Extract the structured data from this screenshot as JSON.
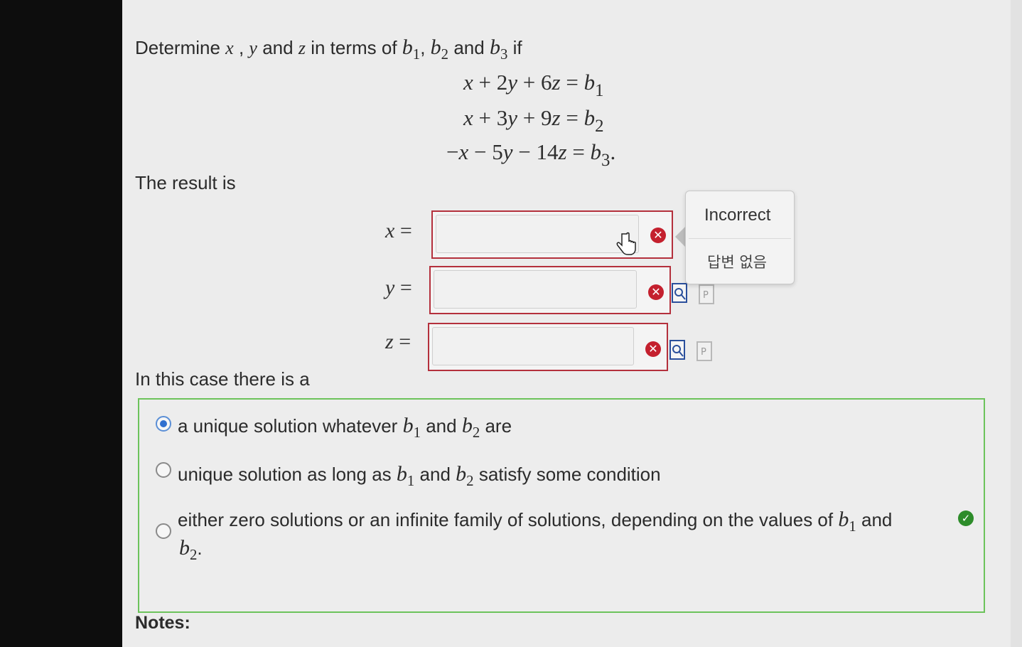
{
  "question": {
    "prefix": "Determine",
    "var_x": "x",
    "comma": ",",
    "var_y": "y",
    "and_word": "and",
    "var_z": "z",
    "in_terms_of": "in terms of",
    "b": "b",
    "sub1": "1",
    "sub2": "2",
    "sub3": "3",
    "if_word": "if"
  },
  "equations": [
    {
      "lhs_pre": "",
      "c1": "x",
      "op1": "+",
      "n2": "2",
      "c2": "y",
      "op2": "+",
      "n3": "6",
      "c3": "z",
      "eq": "=",
      "rhs": "b",
      "rsub": "1",
      "end": ""
    },
    {
      "lhs_pre": "",
      "c1": "x",
      "op1": "+",
      "n2": "3",
      "c2": "y",
      "op2": "+",
      "n3": "9",
      "c3": "z",
      "eq": "=",
      "rhs": "b",
      "rsub": "2",
      "end": ""
    },
    {
      "lhs_pre": "−",
      "c1": "x",
      "op1": "−",
      "n2": "5",
      "c2": "y",
      "op2": "−",
      "n3": "14",
      "c3": "z",
      "eq": "=",
      "rhs": "b",
      "rsub": "3",
      "end": "."
    }
  ],
  "result_label": "The result is",
  "answers": [
    {
      "var": "x",
      "eq": "=",
      "value": "",
      "status": "incorrect"
    },
    {
      "var": "y",
      "eq": "=",
      "value": "",
      "status": "incorrect"
    },
    {
      "var": "z",
      "eq": "=",
      "value": "",
      "status": "incorrect"
    }
  ],
  "tooltip": {
    "title": "Incorrect",
    "message": "답변 없음"
  },
  "case_label": "In this case there is a",
  "options": [
    {
      "t1": "a unique solution whatever",
      "t2": "and",
      "t3": "are",
      "t4": "",
      "selected": true
    },
    {
      "t1": "unique solution as long as",
      "t2": "and",
      "t3": "satisfy some condition",
      "t4": "",
      "selected": false
    },
    {
      "t1": "either zero solutions or an infinite family of solutions, depending on the values of",
      "t2": "and",
      "t3": ".",
      "t4": "",
      "selected": false
    }
  ],
  "notes_label": "Notes:",
  "colors": {
    "error": "#c4202e",
    "correct": "#2d8c2a",
    "choices_border": "#6cc35b",
    "radio_selected": "#2f6fcf"
  }
}
